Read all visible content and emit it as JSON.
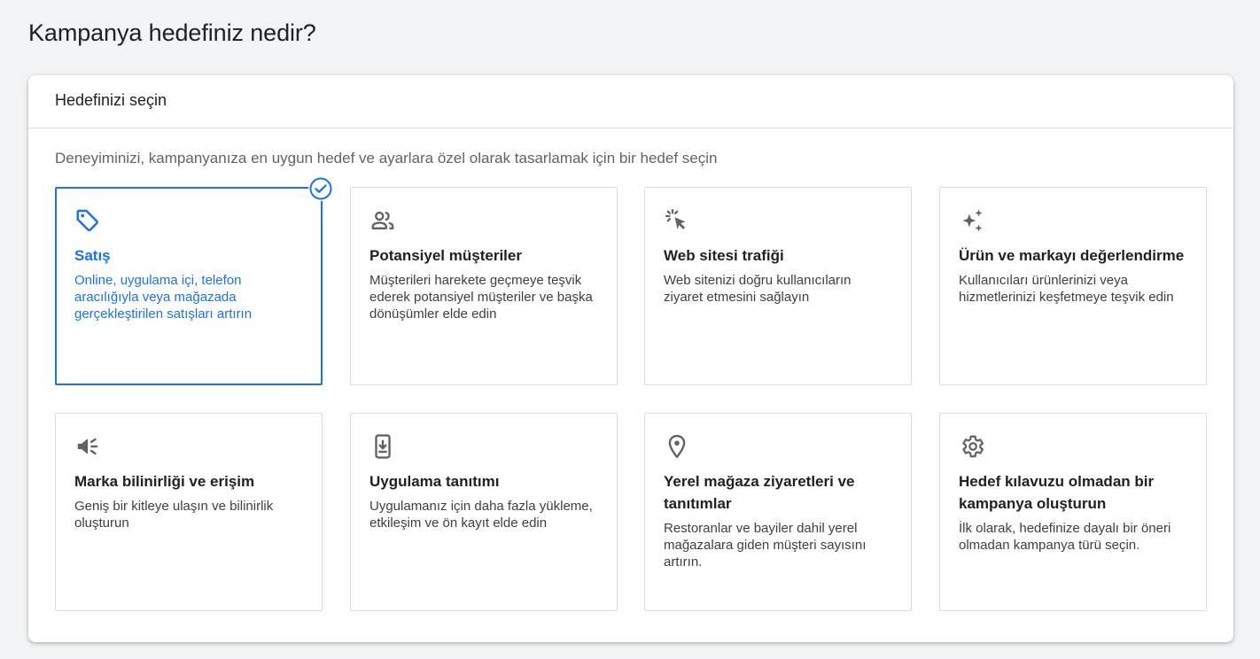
{
  "page": {
    "title": "Kampanya hedefiniz nedir?"
  },
  "panel": {
    "header": "Hedefinizi seçin",
    "description": "Deneyiminizi, kampanyanıza en uygun hedef ve ayarlara özel olarak tasarlamak için bir hedef seçin"
  },
  "colors": {
    "accent": "#1a73e8",
    "border": "#dadce0",
    "background": "#f1f3f4"
  },
  "goals": [
    {
      "icon": "tag-icon",
      "title": "Satış",
      "description": "Online, uygulama içi, telefon aracılığıyla veya mağazada gerçekleştirilen satışları artırın",
      "selected": true
    },
    {
      "icon": "people-icon",
      "title": "Potansiyel müşteriler",
      "description": "Müşterileri harekete geçmeye teşvik ederek potansiyel müşteriler ve başka dönüşümler elde edin",
      "selected": false
    },
    {
      "icon": "cursor-click-icon",
      "title": "Web sitesi trafiği",
      "description": "Web sitenizi doğru kullanıcıların ziyaret etmesini sağlayın",
      "selected": false
    },
    {
      "icon": "sparkle-icon",
      "title": "Ürün ve markayı değerlendirme",
      "description": "Kullanıcıları ürünlerinizi veya hizmetlerinizi keşfetmeye teşvik edin",
      "selected": false
    },
    {
      "icon": "megaphone-icon",
      "title": "Marka bilinirliği ve erişim",
      "description": "Geniş bir kitleye ulaşın ve bilinirlik oluşturun",
      "selected": false
    },
    {
      "icon": "phone-download-icon",
      "title": "Uygulama tanıtımı",
      "description": "Uygulamanız için daha fazla yükleme, etkileşim ve ön kayıt elde edin",
      "selected": false
    },
    {
      "icon": "location-pin-icon",
      "title": "Yerel mağaza ziyaretleri ve tanıtımlar",
      "description": "Restoranlar ve bayiler dahil yerel mağazalara giden müşteri sayısını artırın.",
      "selected": false
    },
    {
      "icon": "gear-icon",
      "title": "Hedef kılavuzu olmadan bir kampanya oluşturun",
      "description": "İlk olarak, hedefinize dayalı bir öneri olmadan kampanya türü seçin.",
      "selected": false
    }
  ]
}
